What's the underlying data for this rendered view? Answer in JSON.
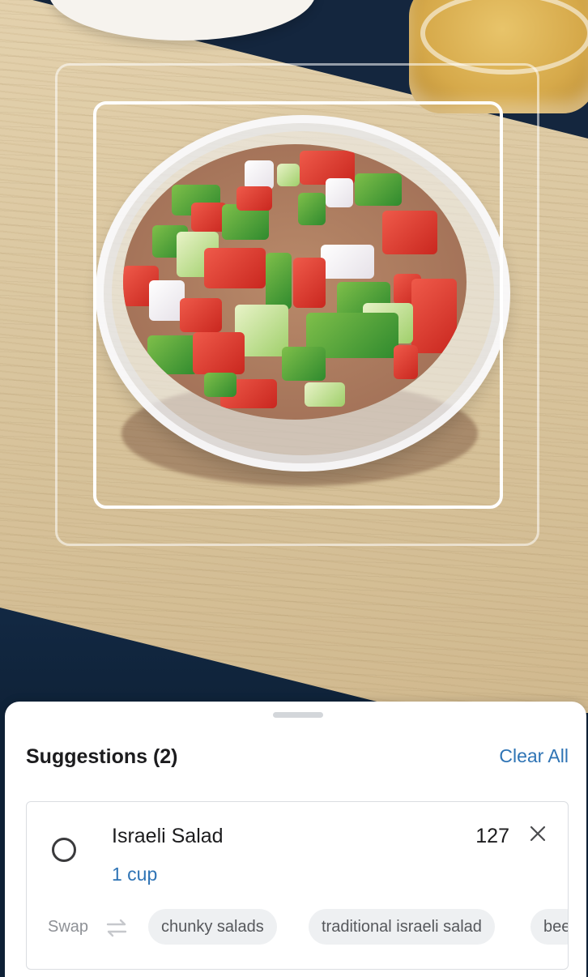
{
  "sheet": {
    "title": "Suggestions (2)",
    "clear_all_label": "Clear All"
  },
  "suggestion": {
    "name": "Israeli Salad",
    "amount": "1 cup",
    "calories": "127",
    "selected": false,
    "swap_label": "Swap",
    "swap_options": [
      "chunky salads",
      "traditional israeli salad",
      "bee"
    ]
  },
  "icons": {
    "radio": "radio-unchecked-icon",
    "remove": "close-icon",
    "swap": "swap-arrows-icon"
  },
  "colors": {
    "accent": "#2f74b5",
    "frame": "#ffffff",
    "chip_bg": "#eef0f2"
  }
}
